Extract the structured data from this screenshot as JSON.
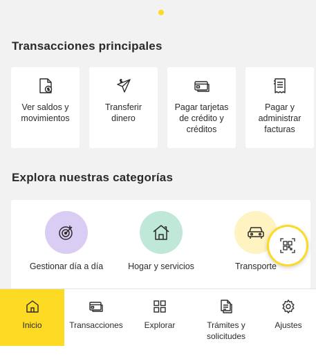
{
  "transacciones": {
    "title": "Transacciones principales",
    "items": [
      {
        "label": "Ver saldos y movimientos",
        "icon": "document-money-icon"
      },
      {
        "label": "Transferir dinero",
        "icon": "paper-plane-money-icon"
      },
      {
        "label": "Pagar tarjetas de crédito y créditos",
        "icon": "credit-card-icon"
      },
      {
        "label": "Pagar y administrar facturas",
        "icon": "invoice-icon"
      }
    ]
  },
  "categorias": {
    "title": "Explora nuestras categorías",
    "items": [
      {
        "label": "Gestionar día a día",
        "icon": "target-icon",
        "color": "#d9cdf3"
      },
      {
        "label": "Hogar y servicios",
        "icon": "house-icon",
        "color": "#bfe8d8"
      },
      {
        "label": "Transporte",
        "icon": "car-icon",
        "color": "#fff3c2"
      }
    ]
  },
  "qr_button": {
    "icon": "qr-scan-icon",
    "accent": "#fdda24"
  },
  "bottom_nav": {
    "items": [
      {
        "label": "Inicio",
        "icon": "home-icon",
        "active": true
      },
      {
        "label": "Transacciones",
        "icon": "credit-card-icon"
      },
      {
        "label": "Explorar",
        "icon": "grid-icon"
      },
      {
        "label": "Trámites y solicitudes",
        "icon": "documents-icon"
      },
      {
        "label": "Ajustes",
        "icon": "gear-icon"
      }
    ]
  },
  "colors": {
    "brand_yellow": "#fdda24",
    "background": "#f2f2f2",
    "text": "#2c2a29"
  }
}
